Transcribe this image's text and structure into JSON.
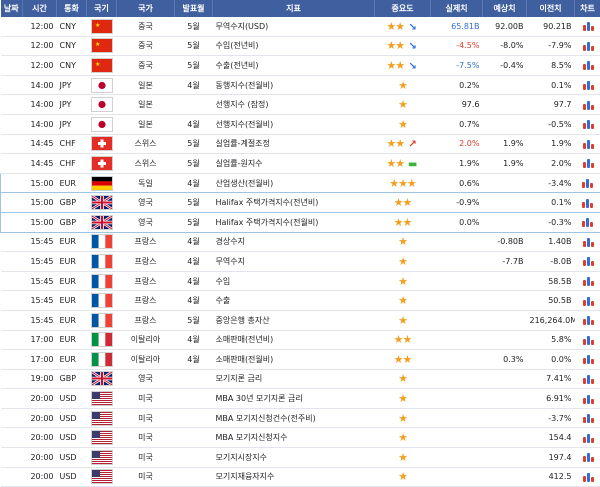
{
  "header": {
    "date": "날짜",
    "time": "시간",
    "currency": "통화",
    "country_flag": "국기",
    "country": "국가",
    "period": "발표월",
    "indicator": "지표",
    "importance": "중요도",
    "actual": "실제치",
    "forecast": "예상치",
    "previous": "이전치",
    "chart": "차트"
  },
  "rows": [
    {
      "time": "12:00",
      "cur": "CNY",
      "flag": "cn",
      "country": "중국",
      "period": "5월",
      "name": "무역수지(USD)",
      "stars": 2,
      "trend": "down",
      "actual": "65.81B",
      "adir": "down",
      "forecast": "92.00B",
      "prev": "90.21B"
    },
    {
      "time": "12:00",
      "cur": "CNY",
      "flag": "cn",
      "country": "중국",
      "period": "5월",
      "name": "수입(전년비)",
      "stars": 2,
      "trend": "down",
      "actual": "-4.5%",
      "adir": "up",
      "forecast": "-8.0%",
      "prev": "-7.9%"
    },
    {
      "time": "12:00",
      "cur": "CNY",
      "flag": "cn",
      "country": "중국",
      "period": "5월",
      "name": "수출(전년비)",
      "stars": 2,
      "trend": "down",
      "actual": "-7.5%",
      "adir": "down",
      "forecast": "-0.4%",
      "prev": "8.5%"
    },
    {
      "time": "14:00",
      "cur": "JPY",
      "flag": "jp",
      "country": "일본",
      "period": "4월",
      "name": "동행지수(전월비)",
      "stars": 1,
      "trend": "",
      "actual": "0.2%",
      "adir": "",
      "forecast": "",
      "prev": "0.1%"
    },
    {
      "time": "14:00",
      "cur": "JPY",
      "flag": "jp",
      "country": "일본",
      "period": "",
      "name": "선행지수 (잠정)",
      "stars": 1,
      "trend": "",
      "actual": "97.6",
      "adir": "",
      "forecast": "",
      "prev": "97.7"
    },
    {
      "time": "14:00",
      "cur": "JPY",
      "flag": "jp",
      "country": "일본",
      "period": "4월",
      "name": "선행지수(전월비)",
      "stars": 1,
      "trend": "",
      "actual": "0.7%",
      "adir": "",
      "forecast": "",
      "prev": "-0.5%"
    },
    {
      "time": "14:45",
      "cur": "CHF",
      "flag": "ch",
      "country": "스위스",
      "period": "5월",
      "name": "실업률-계절조정",
      "stars": 2,
      "trend": "up",
      "actual": "2.0%",
      "adir": "up",
      "forecast": "1.9%",
      "prev": "1.9%"
    },
    {
      "time": "14:45",
      "cur": "CHF",
      "flag": "ch",
      "country": "스위스",
      "period": "5월",
      "name": "실업률-원지수",
      "stars": 2,
      "trend": "flat",
      "actual": "1.9%",
      "adir": "",
      "forecast": "1.9%",
      "prev": "2.0%"
    },
    {
      "time": "15:00",
      "cur": "EUR",
      "flag": "de",
      "country": "독일",
      "period": "4월",
      "name": "산업생산(전월비)",
      "stars": 3,
      "trend": "",
      "actual": "0.6%",
      "adir": "",
      "forecast": "",
      "prev": "-3.4%",
      "hl": true
    },
    {
      "time": "15:00",
      "cur": "GBP",
      "flag": "gb",
      "country": "영국",
      "period": "5월",
      "name": "Halifax 주택가격지수(전년비)",
      "stars": 2,
      "trend": "",
      "actual": "-0.9%",
      "adir": "",
      "forecast": "",
      "prev": "0.1%",
      "hl": true
    },
    {
      "time": "15:00",
      "cur": "GBP",
      "flag": "gb",
      "country": "영국",
      "period": "5월",
      "name": "Halifax 주택가격지수(전월비)",
      "stars": 2,
      "trend": "",
      "actual": "0.0%",
      "adir": "",
      "forecast": "",
      "prev": "-0.3%",
      "hl": true
    },
    {
      "time": "15:45",
      "cur": "EUR",
      "flag": "fr",
      "country": "프랑스",
      "period": "4월",
      "name": "경상수지",
      "stars": 1,
      "trend": "",
      "actual": "",
      "adir": "",
      "forecast": "-0.80B",
      "prev": "1.40B"
    },
    {
      "time": "15:45",
      "cur": "EUR",
      "flag": "fr",
      "country": "프랑스",
      "period": "4월",
      "name": "무역수지",
      "stars": 1,
      "trend": "",
      "actual": "",
      "adir": "",
      "forecast": "-7.7B",
      "prev": "-8.0B"
    },
    {
      "time": "15:45",
      "cur": "EUR",
      "flag": "fr",
      "country": "프랑스",
      "period": "4월",
      "name": "수입",
      "stars": 1,
      "trend": "",
      "actual": "",
      "adir": "",
      "forecast": "",
      "prev": "58.5B"
    },
    {
      "time": "15:45",
      "cur": "EUR",
      "flag": "fr",
      "country": "프랑스",
      "period": "4월",
      "name": "수출",
      "stars": 1,
      "trend": "",
      "actual": "",
      "adir": "",
      "forecast": "",
      "prev": "50.5B"
    },
    {
      "time": "15:45",
      "cur": "EUR",
      "flag": "fr",
      "country": "프랑스",
      "period": "5월",
      "name": "중앙은행 총자산",
      "stars": 1,
      "trend": "",
      "actual": "",
      "adir": "",
      "forecast": "",
      "prev": "216,264.0M"
    },
    {
      "time": "17:00",
      "cur": "EUR",
      "flag": "it",
      "country": "이탈리아",
      "period": "4월",
      "name": "소매판매(전년비)",
      "stars": 2,
      "trend": "",
      "actual": "",
      "adir": "",
      "forecast": "",
      "prev": "5.8%"
    },
    {
      "time": "17:00",
      "cur": "EUR",
      "flag": "it",
      "country": "이탈리아",
      "period": "4월",
      "name": "소매판매(전월비)",
      "stars": 2,
      "trend": "",
      "actual": "",
      "adir": "",
      "forecast": "0.3%",
      "prev": "0.0%"
    },
    {
      "time": "19:00",
      "cur": "GBP",
      "flag": "gb",
      "country": "영국",
      "period": "",
      "name": "모기지론 금리",
      "stars": 1,
      "trend": "",
      "actual": "",
      "adir": "",
      "forecast": "",
      "prev": "7.41%"
    },
    {
      "time": "20:00",
      "cur": "USD",
      "flag": "us",
      "country": "미국",
      "period": "",
      "name": "MBA 30년 모기지론 금리",
      "stars": 1,
      "trend": "",
      "actual": "",
      "adir": "",
      "forecast": "",
      "prev": "6.91%"
    },
    {
      "time": "20:00",
      "cur": "USD",
      "flag": "us",
      "country": "미국",
      "period": "",
      "name": "MBA 모기지신청건수(전주비)",
      "stars": 1,
      "trend": "",
      "actual": "",
      "adir": "",
      "forecast": "",
      "prev": "-3.7%"
    },
    {
      "time": "20:00",
      "cur": "USD",
      "flag": "us",
      "country": "미국",
      "period": "",
      "name": "MBA 모기지신청지수",
      "stars": 1,
      "trend": "",
      "actual": "",
      "adir": "",
      "forecast": "",
      "prev": "154.4"
    },
    {
      "time": "20:00",
      "cur": "USD",
      "flag": "us",
      "country": "미국",
      "period": "",
      "name": "모기지시장지수",
      "stars": 1,
      "trend": "",
      "actual": "",
      "adir": "",
      "forecast": "",
      "prev": "197.4"
    },
    {
      "time": "20:00",
      "cur": "USD",
      "flag": "us",
      "country": "미국",
      "period": "",
      "name": "모기지재융자지수",
      "stars": 1,
      "trend": "",
      "actual": "",
      "adir": "",
      "forecast": "",
      "prev": "412.5"
    }
  ],
  "colors": {
    "header": "#3f5f9e",
    "up": "#e03b2b",
    "down": "#2f6fd6",
    "star": "#f0a020",
    "highlight": "#9ec4e4"
  }
}
